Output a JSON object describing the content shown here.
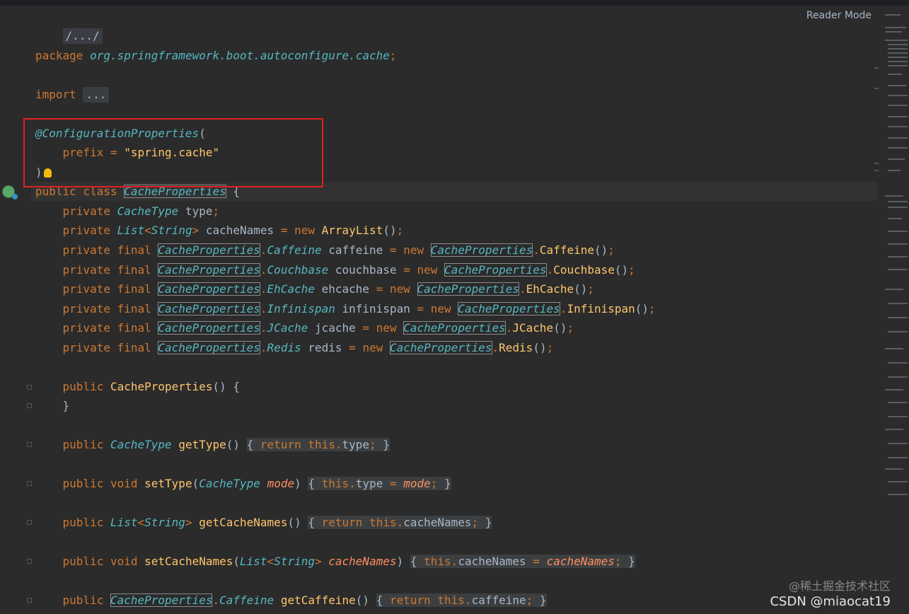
{
  "header": {
    "reader_mode": "Reader Mode"
  },
  "code": {
    "fold_header": "/.../",
    "package_kw": "package",
    "package_name": "org.springframework.boot.autoconfigure.cache",
    "import_kw": "import",
    "import_fold": "...",
    "annotation": "@ConfigurationProperties",
    "prefix_attr": "prefix",
    "prefix_value": "\"spring.cache\"",
    "class_decl_kw": "public class",
    "class_name": "CacheProperties",
    "fields": [
      {
        "mods": "private",
        "type": "CacheType",
        "name": "type",
        "init": ""
      },
      {
        "mods": "private",
        "type": "List<String>",
        "name": "cacheNames",
        "init": "new ArrayList()"
      },
      {
        "mods": "private final",
        "outer": "CacheProperties",
        "inner": "Caffeine",
        "name": "caffeine"
      },
      {
        "mods": "private final",
        "outer": "CacheProperties",
        "inner": "Couchbase",
        "name": "couchbase"
      },
      {
        "mods": "private final",
        "outer": "CacheProperties",
        "inner": "EhCache",
        "name": "ehcache"
      },
      {
        "mods": "private final",
        "outer": "CacheProperties",
        "inner": "Infinispan",
        "name": "infinispan"
      },
      {
        "mods": "private final",
        "outer": "CacheProperties",
        "inner": "JCache",
        "name": "jcache"
      },
      {
        "mods": "private final",
        "outer": "CacheProperties",
        "inner": "Redis",
        "name": "redis"
      }
    ],
    "constructor": "CacheProperties",
    "methods": {
      "getType": "getType",
      "setType": "setType",
      "getCacheNames": "getCacheNames",
      "setCacheNames": "setCacheNames",
      "getCaffeine": "getCaffeine"
    }
  },
  "watermark": {
    "line1": "@稀土掘金技术社区",
    "line2": "CSDN @miaocat19"
  },
  "colors": {
    "background": "#2b2b2b",
    "keyword": "#cc7832",
    "type_italic": "#56b6c2",
    "string": "#6a8759",
    "highlight_box": "#e02020"
  }
}
